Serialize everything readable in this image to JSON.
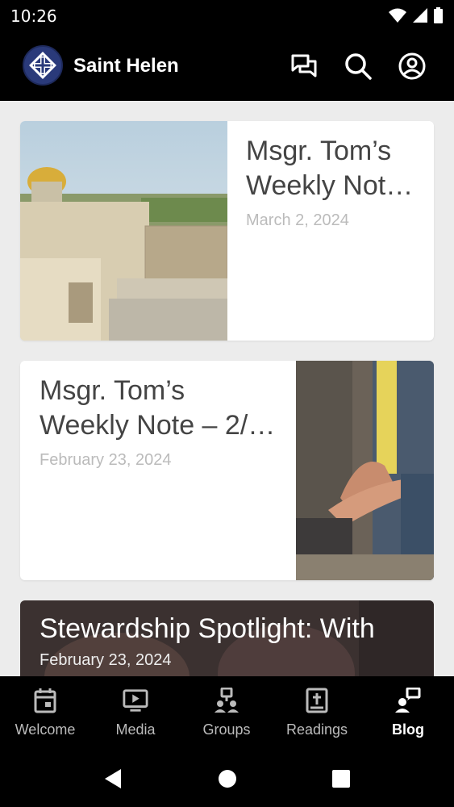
{
  "status": {
    "time": "10:26"
  },
  "app": {
    "title": "Saint Helen"
  },
  "posts": [
    {
      "title_line1": "Msgr. Tom’s",
      "title_line2": "Weekly Note…",
      "date": "March 2, 2024"
    },
    {
      "title_line1": "Msgr. Tom’s",
      "title_line2": "Weekly Note – 2/…",
      "date": "February 23, 2024"
    },
    {
      "title": "Stewardship Spotlight: With",
      "date": "February 23, 2024"
    }
  ],
  "nav": [
    {
      "label": "Welcome",
      "icon": "calendar-icon"
    },
    {
      "label": "Media",
      "icon": "media-play-icon"
    },
    {
      "label": "Groups",
      "icon": "groups-icon"
    },
    {
      "label": "Readings",
      "icon": "bible-icon"
    },
    {
      "label": "Blog",
      "icon": "blog-icon"
    }
  ],
  "nav_active": "Blog",
  "colors": {
    "background": "#ececec",
    "bar": "#000000",
    "title_text": "#444444",
    "date_text": "#bbbbbb"
  }
}
